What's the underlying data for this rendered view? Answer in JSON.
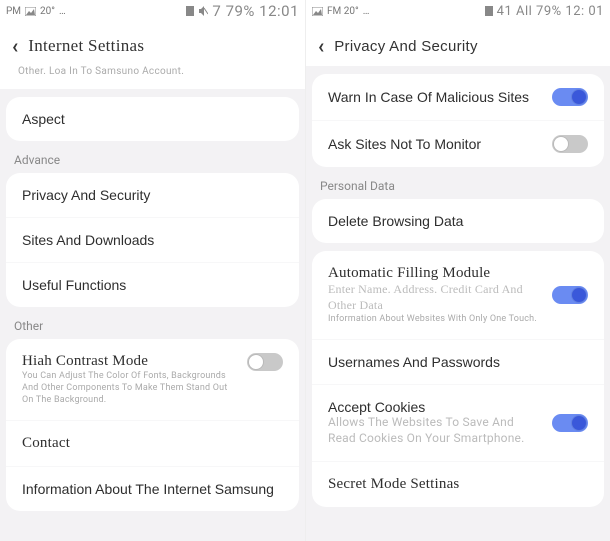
{
  "left": {
    "status": {
      "label": "PM",
      "temp": "20°",
      "extra": "…",
      "right": "7 79% 12:01"
    },
    "header": {
      "title": "Internet Settinas"
    },
    "login_hint": "Other. Loa In To Samsuno Account.",
    "aspect": "Aspect",
    "advance_label": "Advance",
    "privacy": "Privacy And Security",
    "sites": "Sites And Downloads",
    "useful": "Useful Functions",
    "other_label": "Other",
    "high_contrast": {
      "title": "Hiah Contrast Mode",
      "desc": "You Can Adjust The Color Of Fonts, Backgrounds And Other Components To Make Them Stand Out On The Background."
    },
    "contact": "Contact",
    "about": "Information About The Internet Samsung"
  },
  "right": {
    "status": {
      "label": "FM 20°",
      "extra": "…",
      "right": "41 All 79% 12: 01"
    },
    "header": {
      "title": "Privacy And Security"
    },
    "warn": "Warn In Case Of Malicious Sites",
    "ask_no_track": "Ask Sites Not To Monitor",
    "personal_label": "Personal Data",
    "delete": "Delete Browsing Data",
    "autofill": {
      "title": "Automatic Filling Module",
      "line1": "Enter Name. Address. Credit Card And Other Data",
      "line2": "Information About Websites With Only One Touch."
    },
    "userpass": "Usernames And Passwords",
    "cookies": {
      "title": "Accept Cookies",
      "desc": "Allows The Websites To Save And Read Cookies On Your Smartphone."
    },
    "secret": "Secret Mode Settinas"
  }
}
